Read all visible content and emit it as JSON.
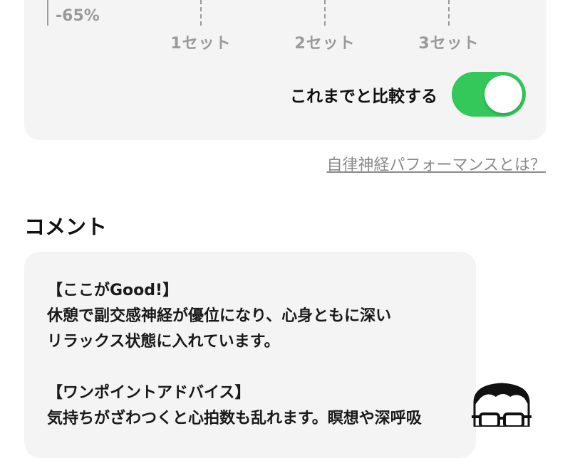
{
  "chart": {
    "axis_label": "-65%",
    "sets": [
      "1セット",
      "2セット",
      "3セット"
    ]
  },
  "compare": {
    "label": "これまでと比較する",
    "enabled": true,
    "on_color": "#34c759"
  },
  "help_link": "自律神経パフォーマンスとは？",
  "comment": {
    "title": "コメント",
    "lines": [
      "【ここがGood!】",
      "休憩で副交感神経が優位になり、心身ともに深い",
      "リラックス状態に入れています。",
      "",
      "【ワンポイントアドバイス】",
      "気持ちがざわつくと心拍数も乱れます。瞑想や深呼吸"
    ]
  },
  "avatar_icon": "glasses-man-avatar-icon"
}
